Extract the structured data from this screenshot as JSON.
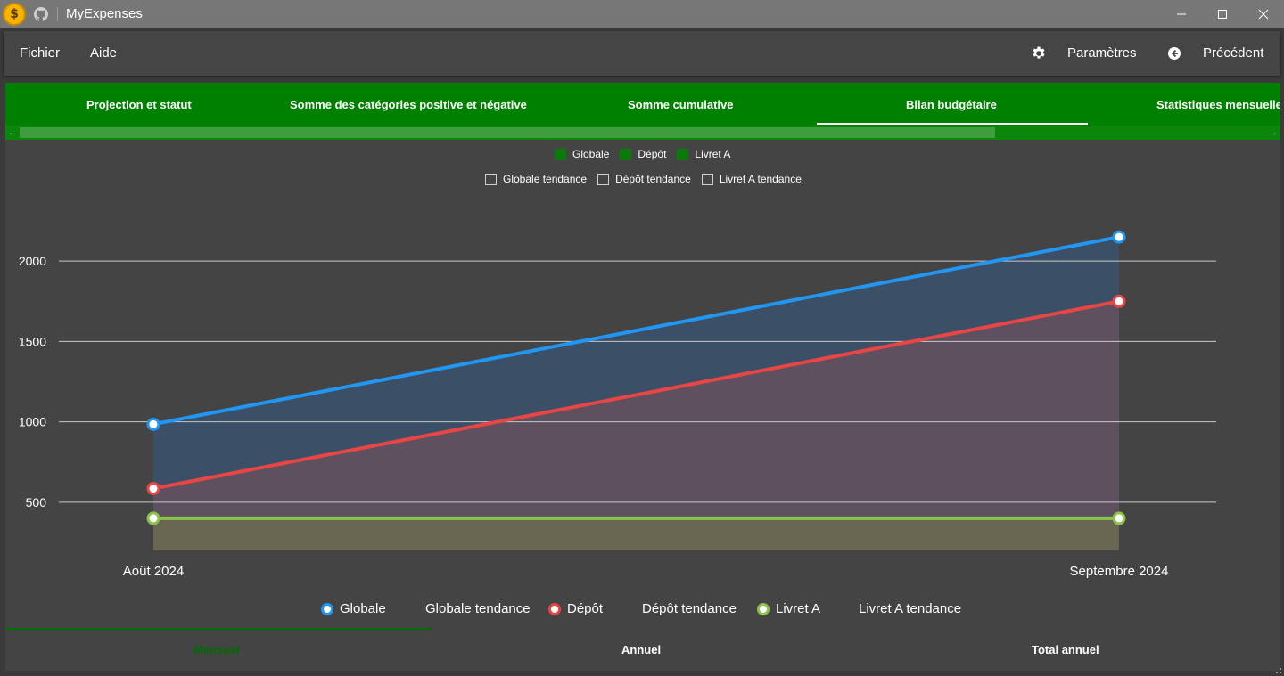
{
  "window": {
    "title": "MyExpenses"
  },
  "menu": {
    "file": "Fichier",
    "help": "Aide",
    "settings": "Paramètres",
    "back": "Précédent"
  },
  "tabs": [
    {
      "label": "Projection et statut"
    },
    {
      "label": "Somme des catégories positive et négative"
    },
    {
      "label": "Somme cumulative"
    },
    {
      "label": "Bilan budgétaire"
    },
    {
      "label": "Statistiques mensuelles"
    }
  ],
  "active_tab": "Bilan budgétaire",
  "series_toggles": [
    {
      "label": "Globale",
      "checked": true
    },
    {
      "label": "Dépôt",
      "checked": true
    },
    {
      "label": "Livret A",
      "checked": true
    }
  ],
  "trend_toggles": [
    {
      "label": "Globale tendance",
      "checked": false
    },
    {
      "label": "Dépôt tendance",
      "checked": false
    },
    {
      "label": "Livret A tendance",
      "checked": false
    }
  ],
  "legend": {
    "globale": "Globale",
    "globale_trend": "Globale tendance",
    "depot": "Dépôt",
    "depot_trend": "Dépôt tendance",
    "livret": "Livret A",
    "livret_trend": "Livret A tendance"
  },
  "bottom_tabs": [
    {
      "label": "Mensuel"
    },
    {
      "label": "Annuel"
    },
    {
      "label": "Total annuel"
    }
  ],
  "active_bottom_tab": "Mensuel",
  "colors": {
    "accent": "#008000",
    "globale": "#2196f3",
    "depot": "#e84545",
    "livret": "#8bc34a"
  },
  "chart_data": {
    "type": "area",
    "categories": [
      "Août 2024",
      "Septembre 2024"
    ],
    "series": [
      {
        "name": "Globale",
        "values": [
          985,
          2150
        ]
      },
      {
        "name": "Dépôt",
        "values": [
          585,
          1750
        ]
      },
      {
        "name": "Livret A",
        "values": [
          400,
          400
        ]
      }
    ],
    "yticks": [
      500,
      1000,
      1500,
      2000
    ],
    "ylim": [
      200,
      2300
    ],
    "grid": true,
    "legend": "bottom"
  }
}
